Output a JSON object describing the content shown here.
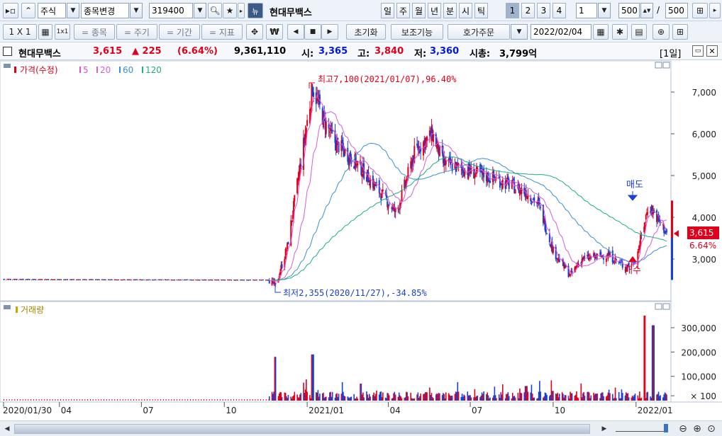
{
  "toolbar1": {
    "market": "주식",
    "change_item": "종목변경",
    "code": "319400",
    "name_badge": "뉴",
    "stock_name": "현대무백스",
    "periods": [
      "일",
      "주",
      "월",
      "년",
      "분",
      "시",
      "틱"
    ],
    "ranges": [
      "1",
      "2",
      "3",
      "4"
    ],
    "range_input": "1",
    "count_value": "500",
    "count_total": "500",
    "slash": "/"
  },
  "toolbar2": {
    "layout_label": "1 X 1",
    "stock_label": "= 종목",
    "cycle_label": "= 주기",
    "period_label": "= 기간",
    "indicator_label": "= 지표",
    "reset_label": "초기화",
    "aux_label": "보조기능",
    "order_label": "호가주문",
    "date_value": "2022/02/04"
  },
  "info": {
    "name": "현대무백스",
    "price": "3,615",
    "change": "▲ 225",
    "change_pct": "(6.64%)",
    "volume": "9,361,110",
    "open_label": "시:",
    "open": "3,365",
    "high_label": "고:",
    "high": "3,840",
    "low_label": "저:",
    "low": "3,360",
    "mktcap_label": "시총:",
    "mktcap": "3,799억",
    "period": "[1일]"
  },
  "price_panel": {
    "legend_main": "가격(수정)",
    "ma": [
      {
        "label": "5",
        "color": "#e14fd6"
      },
      {
        "label": "20",
        "color": "#d060d8"
      },
      {
        "label": "60",
        "color": "#3a8fd6"
      },
      {
        "label": "120",
        "color": "#1fae7e"
      }
    ],
    "high_annotation": "최고7,100(2021/01/07),96.40%",
    "low_annotation": "최저2,355(2020/11/27),-34.85%",
    "sell_label": "매도",
    "buy_label": "매수",
    "current_price_tag": "3,615",
    "current_pct_tag": "6.64%",
    "y_ticks": [
      "7,000",
      "6,000",
      "5,000",
      "4,000",
      "3,000"
    ]
  },
  "volume_panel": {
    "legend": "거래량",
    "y_ticks": [
      "300,000",
      "200,000",
      "100,000",
      "× 100"
    ]
  },
  "x_axis": {
    "ticks": [
      "2020/01/30",
      "04",
      "07",
      "10",
      "2021/01",
      "04",
      "07",
      "10",
      "2022/01"
    ]
  },
  "colors": {
    "up": "#e0001b",
    "down": "#1a3fd6",
    "ma5": "#e14fd6",
    "ma20": "#d060d8",
    "ma60": "#3a8fd6",
    "ma120": "#1fae7e"
  },
  "chart_data": {
    "type": "line",
    "title": "",
    "xlabel": "",
    "ylabel": "",
    "ylim": [
      2300,
      7300
    ],
    "series": [
      {
        "name": "가격(수정)",
        "x": [
          "2020/01/30",
          "2020/04",
          "2020/07",
          "2020/10",
          "2020/11/20",
          "2020/11/27",
          "2020/12/10",
          "2021/01/07",
          "2021/01/20",
          "2021/02",
          "2021/03",
          "2021/04/10",
          "2021/05",
          "2021/05/20",
          "2021/06",
          "2021/07",
          "2021/08",
          "2021/09",
          "2021/09/15",
          "2021/10",
          "2021/10/20",
          "2021/11",
          "2021/12",
          "2021/12/20",
          "2022/01",
          "2022/01/15",
          "2022/02/04"
        ],
        "values": [
          2520,
          2510,
          2505,
          2500,
          2500,
          2355,
          3300,
          7100,
          6300,
          5800,
          5200,
          4100,
          5600,
          6000,
          5300,
          5100,
          4900,
          4600,
          4300,
          3200,
          2600,
          3000,
          3100,
          2800,
          3000,
          4300,
          3615
        ]
      }
    ],
    "volume": {
      "x": [
        "2020/11/27",
        "2021/01/07",
        "2021/03",
        "2021/09",
        "2021/10",
        "2022/01/10",
        "2022/01/20"
      ],
      "values": [
        180000,
        190000,
        70000,
        60000,
        40000,
        350000,
        310000
      ]
    }
  }
}
